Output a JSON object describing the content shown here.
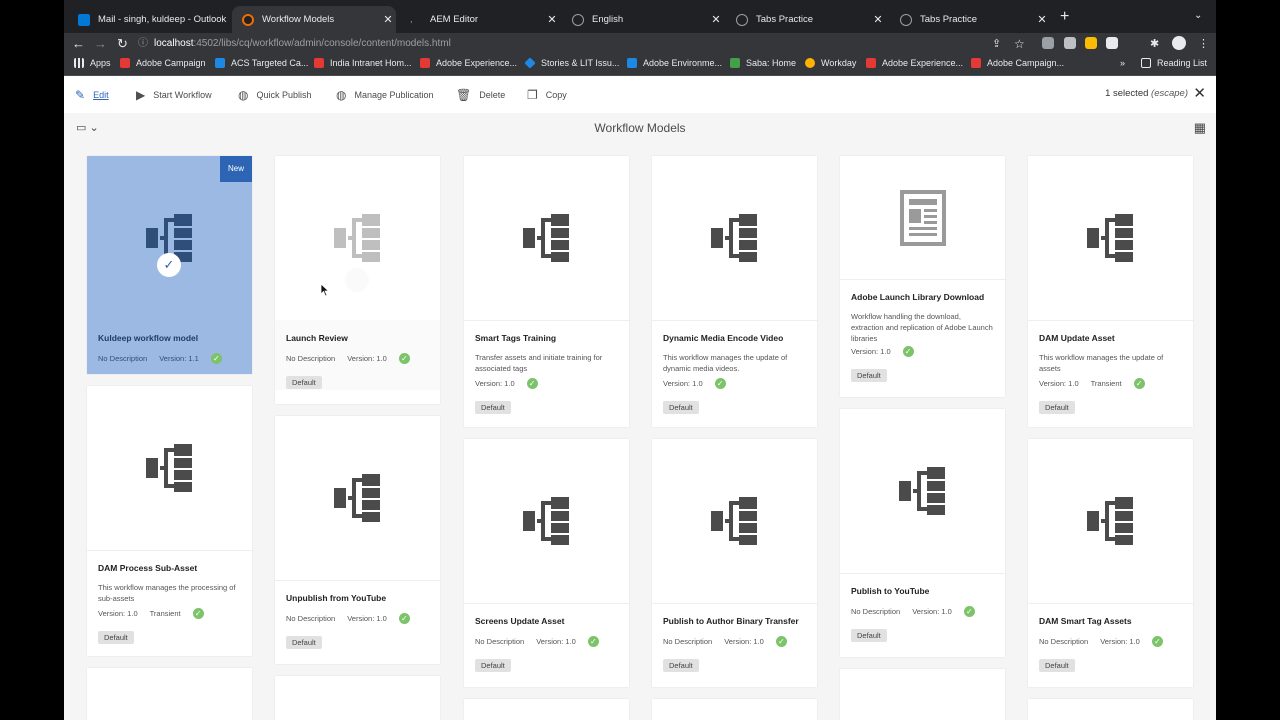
{
  "tabs": [
    {
      "title": "Mail - singh, kuldeep - Outlook",
      "favicon": "outlook-icon",
      "color": "#0078d4",
      "active": false
    },
    {
      "title": "Workflow Models",
      "favicon": "aem-icon",
      "color": "#ef6c00",
      "active": true
    },
    {
      "title": "AEM Editor",
      "favicon": "blank-icon",
      "color": "#202124",
      "active": false
    },
    {
      "title": "English",
      "favicon": "globe-icon",
      "color": "#9aa0a6",
      "active": false
    },
    {
      "title": "Tabs Practice",
      "favicon": "globe-icon",
      "color": "#9aa0a6",
      "active": false
    },
    {
      "title": "Tabs Practice",
      "favicon": "globe-icon",
      "color": "#9aa0a6",
      "active": false
    }
  ],
  "address": {
    "host": "localhost",
    "path": ":4502/libs/cq/workflow/admin/console/content/models.html"
  },
  "bookmarks": [
    {
      "label": "Apps",
      "color": "#e8eaed"
    },
    {
      "label": "Adobe Campaign",
      "color": "#e53935"
    },
    {
      "label": "ACS Targeted Ca...",
      "color": "#1e88e5"
    },
    {
      "label": "India Intranet Hom...",
      "color": "#e53935"
    },
    {
      "label": "Adobe Experience...",
      "color": "#e53935"
    },
    {
      "label": "Stories & LIT Issu...",
      "color": "#ffffff"
    },
    {
      "label": "Adobe Environme...",
      "color": "#1e88e5"
    },
    {
      "label": "Saba: Home",
      "color": "#43a047"
    },
    {
      "label": "Workday",
      "color": "#1e88e5"
    },
    {
      "label": "Adobe Experience...",
      "color": "#e53935"
    },
    {
      "label": "Adobe Campaign...",
      "color": "#e53935"
    }
  ],
  "bookmarks_more": "»",
  "reading_list": "Reading List",
  "toolbar": {
    "edit": "Edit",
    "start_workflow": "Start Workflow",
    "quick_publish": "Quick Publish",
    "manage_publication": "Manage Publication",
    "delete": "Delete",
    "copy": "Copy",
    "selected": "1 selected",
    "escape": "(escape)"
  },
  "page_title": "Workflow Models",
  "cards": [
    {
      "title": "Kuldeep workflow model",
      "description": "",
      "no_desc": "No Description",
      "version": "Version: 1.1",
      "transient": "",
      "tag": "",
      "badge": "New",
      "icon": "workflow-icon",
      "state": "selected"
    },
    {
      "title": "Launch Review",
      "description": "",
      "no_desc": "No Description",
      "version": "Version: 1.0",
      "transient": "",
      "tag": "Default",
      "badge": "",
      "icon": "workflow-icon",
      "state": "dim"
    },
    {
      "title": "Smart Tags Training",
      "description": "Transfer assets and initiate training for associated tags",
      "no_desc": "",
      "version": "Version: 1.0",
      "transient": "",
      "tag": "Default",
      "badge": "",
      "icon": "workflow-icon",
      "state": ""
    },
    {
      "title": "Dynamic Media Encode Video",
      "description": "This workflow manages the update of dynamic media videos.",
      "no_desc": "",
      "version": "Version: 1.0",
      "transient": "",
      "tag": "Default",
      "badge": "",
      "icon": "workflow-icon",
      "state": ""
    },
    {
      "title": "Adobe Launch Library Download",
      "description": "Workflow handling the download, extraction and replication of Adobe Launch libraries",
      "no_desc": "",
      "version": "Version: 1.0",
      "transient": "",
      "tag": "Default",
      "badge": "",
      "icon": "document-icon",
      "state": ""
    },
    {
      "title": "DAM Update Asset",
      "description": "This workflow manages the update of assets",
      "no_desc": "",
      "version": "Version: 1.0",
      "transient": "Transient",
      "tag": "Default",
      "badge": "",
      "icon": "workflow-icon",
      "state": ""
    },
    {
      "title": "DAM Process Sub-Asset",
      "description": "This workflow manages the processing of sub-assets",
      "no_desc": "",
      "version": "Version: 1.0",
      "transient": "Transient",
      "tag": "Default",
      "badge": "",
      "icon": "workflow-icon",
      "state": ""
    },
    {
      "title": "Unpublish from YouTube",
      "description": "",
      "no_desc": "No Description",
      "version": "Version: 1.0",
      "transient": "",
      "tag": "Default",
      "badge": "",
      "icon": "workflow-icon",
      "state": ""
    },
    {
      "title": "Screens Update Asset",
      "description": "",
      "no_desc": "No Description",
      "version": "Version: 1.0",
      "transient": "",
      "tag": "Default",
      "badge": "",
      "icon": "workflow-icon",
      "state": ""
    },
    {
      "title": "Publish to Author Binary Transfer",
      "description": "",
      "no_desc": "No Description",
      "version": "Version: 1.0",
      "transient": "",
      "tag": "Default",
      "badge": "",
      "icon": "workflow-icon",
      "state": ""
    },
    {
      "title": "Publish to YouTube",
      "description": "",
      "no_desc": "No Description",
      "version": "Version: 1.0",
      "transient": "",
      "tag": "Default",
      "badge": "",
      "icon": "workflow-icon",
      "state": ""
    },
    {
      "title": "DAM Smart Tag Assets",
      "description": "",
      "no_desc": "No Description",
      "version": "Version: 1.0",
      "transient": "",
      "tag": "Default",
      "badge": "",
      "icon": "workflow-icon",
      "state": ""
    }
  ],
  "colors": {
    "accent": "#2d64b3",
    "selected_card": "#9bb9e3",
    "check": "#7cc36a"
  }
}
